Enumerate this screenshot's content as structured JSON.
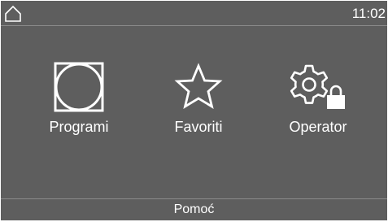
{
  "status_bar": {
    "time": "11:02",
    "home_icon": "home-icon"
  },
  "menu": {
    "items": [
      {
        "label": "Programi",
        "icon": "drum-icon"
      },
      {
        "label": "Favoriti",
        "icon": "star-icon"
      },
      {
        "label": "Operator",
        "icon": "gear-lock-icon"
      }
    ]
  },
  "footer": {
    "help_label": "Pomoć"
  },
  "colors": {
    "background": "#5e5e5e",
    "foreground": "#ffffff",
    "divider": "#8a8a8a"
  }
}
